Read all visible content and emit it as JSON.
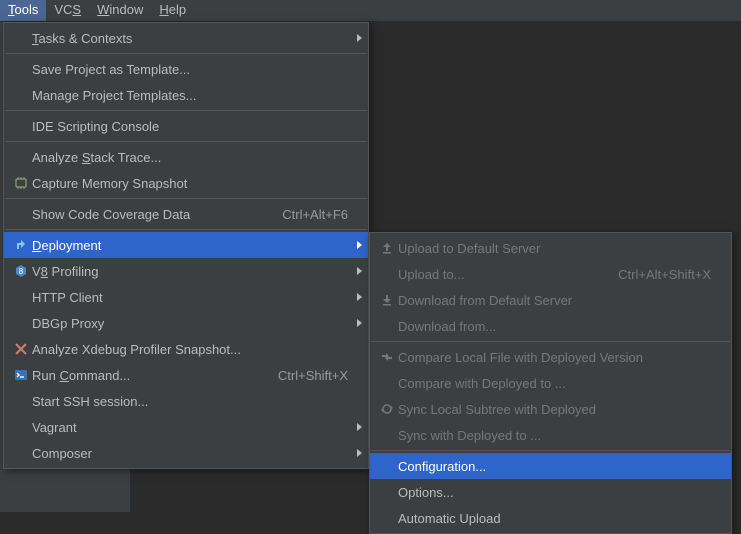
{
  "menubar": {
    "tools": {
      "label": "Tools",
      "mn": "T"
    },
    "vcs": {
      "label": "VCS",
      "mn": "S"
    },
    "window": {
      "label": "Window",
      "mn": "W"
    },
    "help": {
      "label": "Help",
      "mn": "H"
    }
  },
  "tools_menu": {
    "tasks": {
      "label": "Tasks & Contexts",
      "mn": "T"
    },
    "save_tpl": {
      "label": "Save Project as Template..."
    },
    "manage_tpl": {
      "label": "Manage Project Templates..."
    },
    "ide_script": {
      "label": "IDE Scripting Console"
    },
    "stack_trace": {
      "label": "Analyze Stack Trace...",
      "mn": "S"
    },
    "mem_snap": {
      "label": "Capture Memory Snapshot"
    },
    "coverage": {
      "label": "Show Code Coverage Data",
      "shortcut": "Ctrl+Alt+F6"
    },
    "deployment": {
      "label": "Deployment",
      "mn": "D"
    },
    "v8": {
      "label": "V8 Profiling",
      "mn": "8"
    },
    "http": {
      "label": "HTTP Client"
    },
    "dbgp": {
      "label": "DBGp Proxy"
    },
    "xdebug": {
      "label": "Analyze Xdebug Profiler Snapshot..."
    },
    "run_cmd": {
      "label": "Run Command...",
      "mn": "C",
      "shortcut": "Ctrl+Shift+X"
    },
    "ssh": {
      "label": "Start SSH session..."
    },
    "vagrant": {
      "label": "Vagrant"
    },
    "composer": {
      "label": "Composer"
    }
  },
  "deploy_menu": {
    "upload_def": {
      "label": "Upload to Default Server"
    },
    "upload_to": {
      "label": "Upload to...",
      "shortcut": "Ctrl+Alt+Shift+X"
    },
    "download_def": {
      "label": "Download from Default Server"
    },
    "download_from": {
      "label": "Download from..."
    },
    "compare_file": {
      "label": "Compare Local File with Deployed Version"
    },
    "compare_dep": {
      "label": "Compare with Deployed to ..."
    },
    "sync_sub": {
      "label": "Sync Local Subtree with Deployed"
    },
    "sync_dep": {
      "label": "Sync with Deployed to ..."
    },
    "config": {
      "label": "Configuration..."
    },
    "options": {
      "label": "Options..."
    },
    "auto_upload": {
      "label": "Automatic Upload"
    }
  }
}
